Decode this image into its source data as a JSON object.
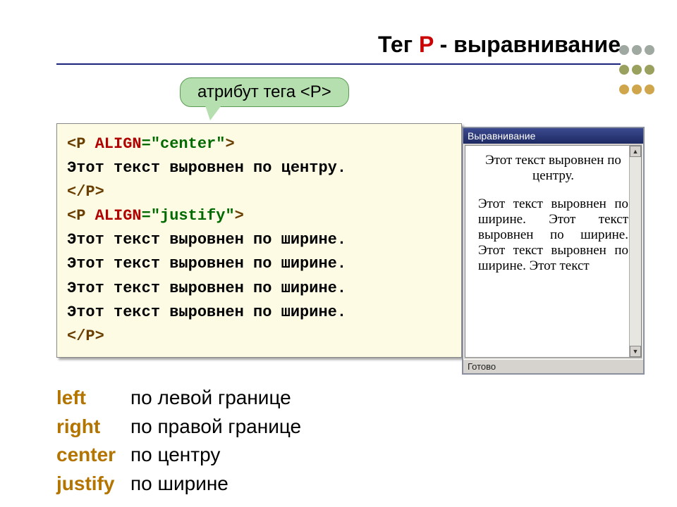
{
  "title": {
    "prefix": "Тег ",
    "highlight": "P",
    "suffix": " - выравнивание"
  },
  "callout": "атрибут тега <P>",
  "code": {
    "open1_a": "<P ",
    "open1_b": "ALIGN",
    "open1_c": "=\"center\"",
    "open1_d": ">",
    "line1": "Этот текст выровнен по центру.",
    "close1": "</P>",
    "open2_a": "<P ",
    "open2_b": "ALIGN",
    "open2_c": "=\"justify\"",
    "open2_d": ">",
    "line2": "Этот текст выровнен по ширине.",
    "line3": "Этот текст выровнен по ширине.",
    "line4": "Этот текст выровнен по ширине.",
    "line5": "Этот текст выровнен по ширине.",
    "close2": "</P>"
  },
  "browser": {
    "title": "Выравнивание",
    "centered": "Этот текст выровнен по центру.",
    "justified": "Этот текст выровнен по ширине. Этот текст выровнен по ширине. Этот текст выровнен по ширине. Этот текст",
    "status": "Готово"
  },
  "legend": {
    "left_kw": "left",
    "left_txt": "по левой границе",
    "right_kw": "right",
    "right_txt": "по правой границе",
    "center_kw": "center",
    "center_txt": "по центру",
    "justify_kw": "justify",
    "justify_txt": "по ширине"
  }
}
